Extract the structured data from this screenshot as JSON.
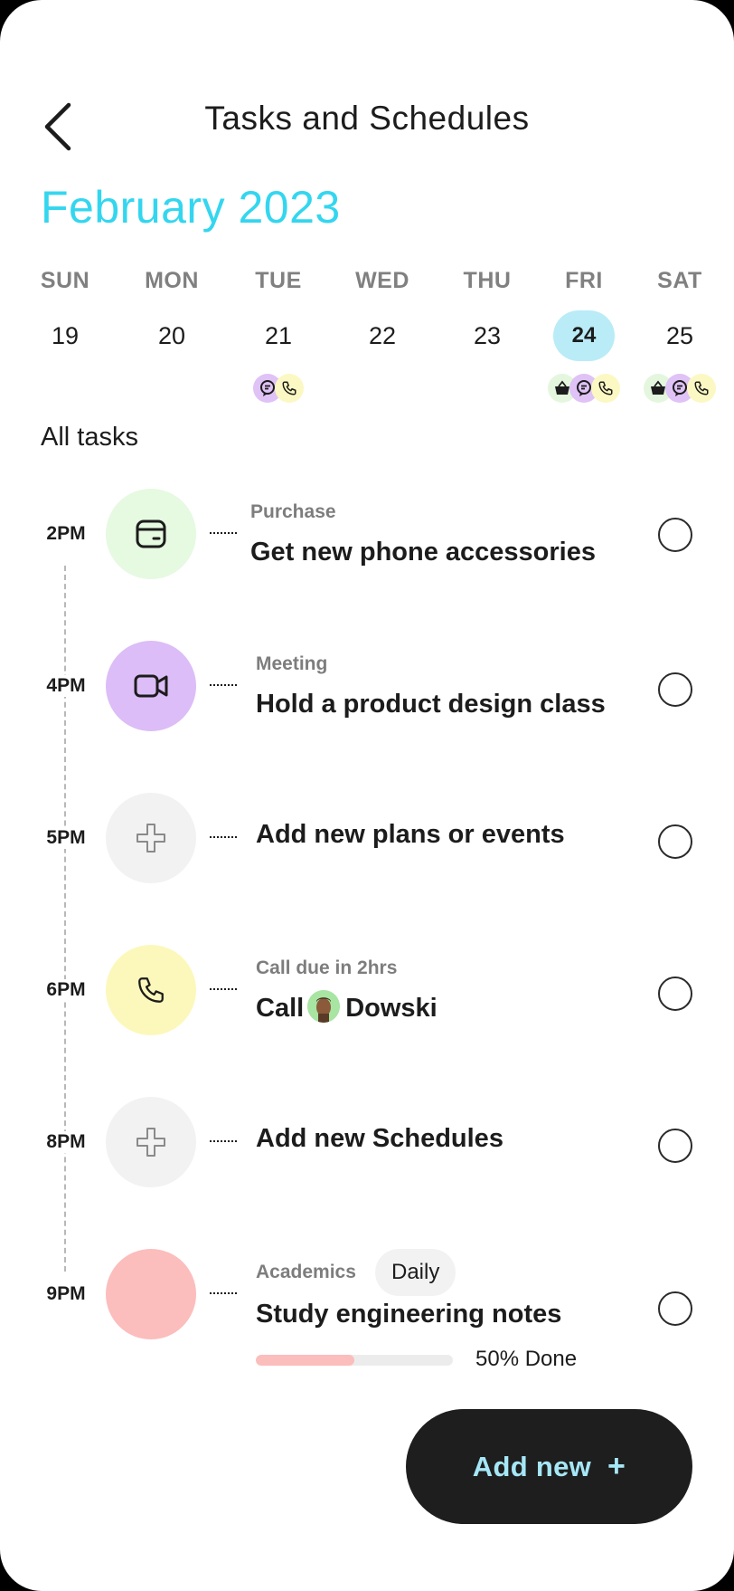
{
  "header": {
    "title": "Tasks and Schedules"
  },
  "calendar": {
    "month": "February 2023",
    "days": [
      {
        "name": "SUN",
        "num": "19",
        "icons": []
      },
      {
        "name": "MON",
        "num": "20",
        "icons": []
      },
      {
        "name": "TUE",
        "num": "21",
        "icons": [
          "chat-icon",
          "phone-icon"
        ]
      },
      {
        "name": "WED",
        "num": "22",
        "icons": []
      },
      {
        "name": "THU",
        "num": "23",
        "icons": []
      },
      {
        "name": "FRI",
        "num": "24",
        "icons": [
          "basket-icon",
          "chat-icon",
          "phone-icon"
        ],
        "selected": true
      },
      {
        "name": "SAT",
        "num": "25",
        "icons": [
          "basket-icon",
          "chat-icon",
          "phone-icon"
        ]
      }
    ]
  },
  "tasks_section": {
    "title": "All tasks",
    "items": [
      {
        "time": "2PM",
        "category": "Purchase",
        "title": "Get new phone accessories",
        "icon": "card-icon",
        "color": "#e6f9e1"
      },
      {
        "time": "4PM",
        "category": "Meeting",
        "title": "Hold a product design class",
        "icon": "video-icon",
        "color": "#dcbdf7"
      },
      {
        "time": "5PM",
        "category": "",
        "title": "Add new plans or events",
        "icon": "plus-icon",
        "color": "#f2f2f2"
      },
      {
        "time": "6PM",
        "category": "Call due in 2hrs",
        "title_prefix": "Call",
        "title_suffix": "Dowski",
        "icon": "phone-icon",
        "avatar": "avatar-icon",
        "color": "#fcf8bc"
      },
      {
        "time": "8PM",
        "category": "",
        "title": "Add new Schedules",
        "icon": "plus-icon",
        "color": "#f2f2f2"
      },
      {
        "time": "9PM",
        "category": "Academics",
        "badge": "Daily",
        "title": "Study engineering notes",
        "progress": 0.5,
        "progress_label": "50% Done",
        "color": "#fcbdbd"
      }
    ]
  },
  "footer": {
    "add_new_label": "Add new",
    "add_new_plus": "+"
  },
  "colors": {
    "accent": "#34d6ef",
    "selected_day": "#b9ecf7",
    "button_bg": "#1e1e1e",
    "button_text": "#a6e7f6"
  }
}
